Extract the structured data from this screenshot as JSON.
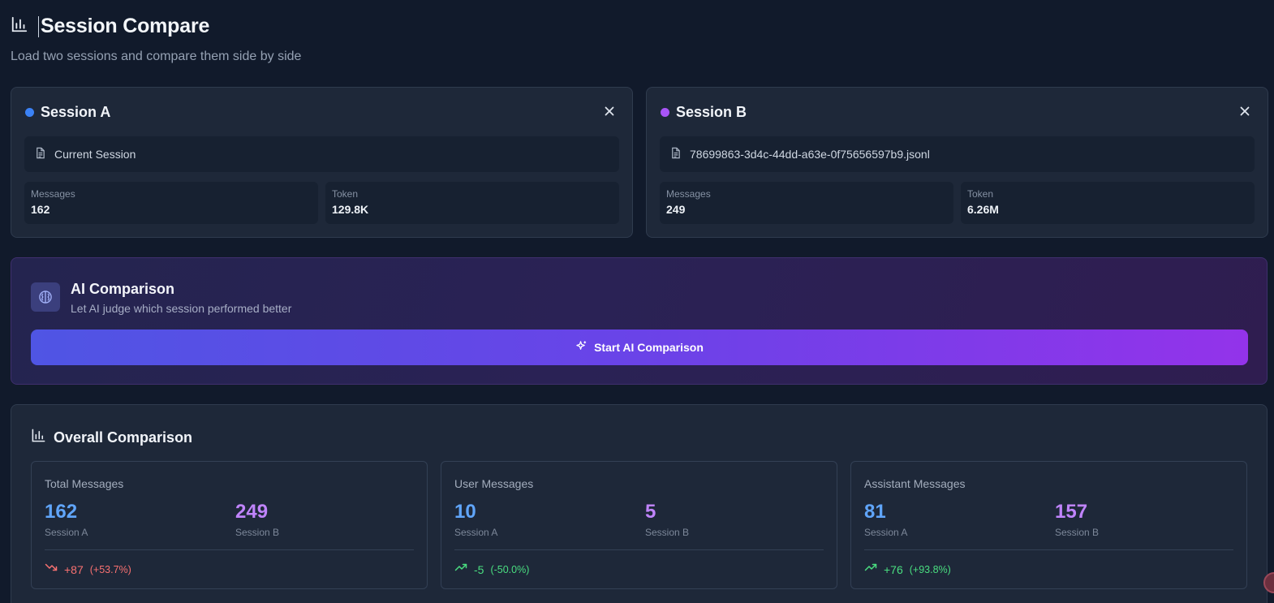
{
  "header": {
    "title": "Session Compare",
    "subtitle": "Load two sessions and compare them side by side"
  },
  "sessions": [
    {
      "title": "Session A",
      "color": "#3b82f6",
      "file": "Current Session",
      "stats": [
        {
          "label": "Messages",
          "value": "162"
        },
        {
          "label": "Token",
          "value": "129.8K"
        }
      ]
    },
    {
      "title": "Session B",
      "color": "#a855f7",
      "file": "78699863-3d4c-44dd-a63e-0f75656597b9.jsonl",
      "stats": [
        {
          "label": "Messages",
          "value": "249"
        },
        {
          "label": "Token",
          "value": "6.26M"
        }
      ]
    }
  ],
  "ai": {
    "title": "AI Comparison",
    "subtitle": "Let AI judge which session performed better",
    "button_label": "Start AI Comparison"
  },
  "overall": {
    "title": "Overall Comparison",
    "metrics": [
      {
        "label": "Total Messages",
        "a_value": "162",
        "a_label": "Session A",
        "b_value": "249",
        "b_label": "Session B",
        "delta": "+87",
        "delta_pct": "(+53.7%)",
        "trend": "down"
      },
      {
        "label": "User Messages",
        "a_value": "10",
        "a_label": "Session A",
        "b_value": "5",
        "b_label": "Session B",
        "delta": "-5",
        "delta_pct": "(-50.0%)",
        "trend": "up"
      },
      {
        "label": "Assistant Messages",
        "a_value": "81",
        "a_label": "Session A",
        "b_value": "157",
        "b_label": "Session B",
        "delta": "+76",
        "delta_pct": "(+93.8%)",
        "trend": "up"
      }
    ]
  },
  "icons": {
    "header": "bar-chart-icon",
    "close": "close-icon",
    "file": "file-icon",
    "ai": "brain-icon",
    "sparkle": "sparkles-icon",
    "trend_down": "trending-down-icon",
    "trend_up": "trending-up-icon"
  },
  "colors": {
    "session_a": "#3b82f6",
    "session_b": "#a855f7",
    "negative": "#f87171",
    "positive": "#4ade80"
  }
}
